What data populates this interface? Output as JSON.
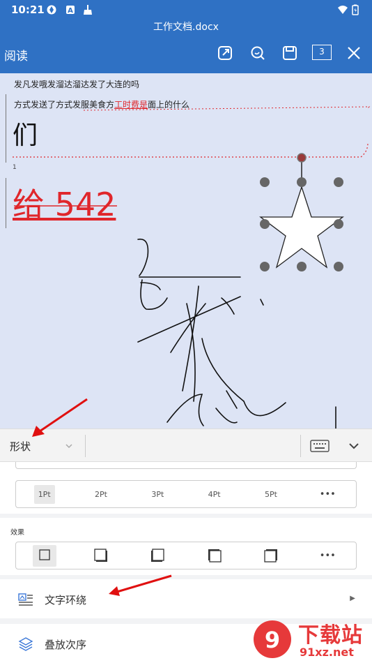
{
  "status": {
    "time": "10:21"
  },
  "title": "工作文档.docx",
  "toolbar": {
    "read_label": "阅读",
    "page_count": "3"
  },
  "document": {
    "line1": "发凡发哦发溜达溜达发了大连的吗",
    "line2_pre": "方式发送了方式发服美食方",
    "line2_red": "工时费是",
    "line2_post": "面上的什么",
    "big_char": "们",
    "page_number": "1",
    "red_text": "给 542"
  },
  "format_bar": {
    "shape_label": "形状"
  },
  "line_width": {
    "options": [
      "1Pt",
      "2Pt",
      "3Pt",
      "4Pt",
      "5Pt"
    ],
    "selected": "1Pt",
    "more": "•••"
  },
  "effects": {
    "label": "效果",
    "more": "•••"
  },
  "menu": {
    "text_wrap": "文字环绕",
    "stack_order": "叠放次序"
  },
  "watermark": {
    "main": "下载站",
    "sub": "91xz.net"
  },
  "colors": {
    "brand": "#2f71c4",
    "doc_bg": "#dde4f5",
    "red": "#e0262b",
    "arrow": "#e01010"
  }
}
